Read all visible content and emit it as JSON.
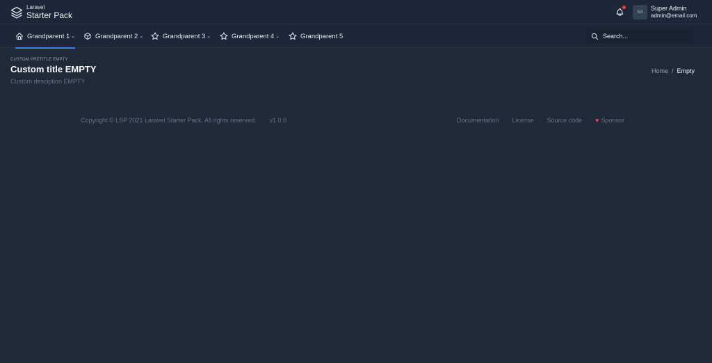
{
  "brand": {
    "line1": "Laravel",
    "line2": "Starter Pack"
  },
  "header": {
    "user_initials": "SA",
    "user_name": "Super Admin",
    "user_email": "admin@email.com",
    "notification_dot_color": "#ef4444"
  },
  "nav": {
    "items": [
      {
        "label": "Grandparent 1",
        "icon": "home-icon",
        "has_dropdown": true,
        "active": true
      },
      {
        "label": "Grandparent 2",
        "icon": "package-icon",
        "has_dropdown": true
      },
      {
        "label": "Grandparent 3",
        "icon": "star-icon",
        "has_dropdown": true
      },
      {
        "label": "Grandparent 4",
        "icon": "star-icon",
        "has_dropdown": true
      },
      {
        "label": "Grandparent 5",
        "icon": "star-icon",
        "has_dropdown": false
      }
    ],
    "search_placeholder": "Search...",
    "active_color": "#3b82f6"
  },
  "page": {
    "pretitle": "CUSTOM PRETITLE EMPTY",
    "title": "Custom title EMPTY",
    "description": "Custom desciption EMPTY",
    "breadcrumb": {
      "home": "Home",
      "separator": "/",
      "current": "Empty"
    }
  },
  "footer": {
    "copyright": "Copyright © LSP 2021 Laravel Starter Pack. All rights reserved.",
    "version": "v1.0.0",
    "links": [
      "Documentation",
      "License",
      "Source code",
      "Sponsor"
    ],
    "dot": "·"
  }
}
